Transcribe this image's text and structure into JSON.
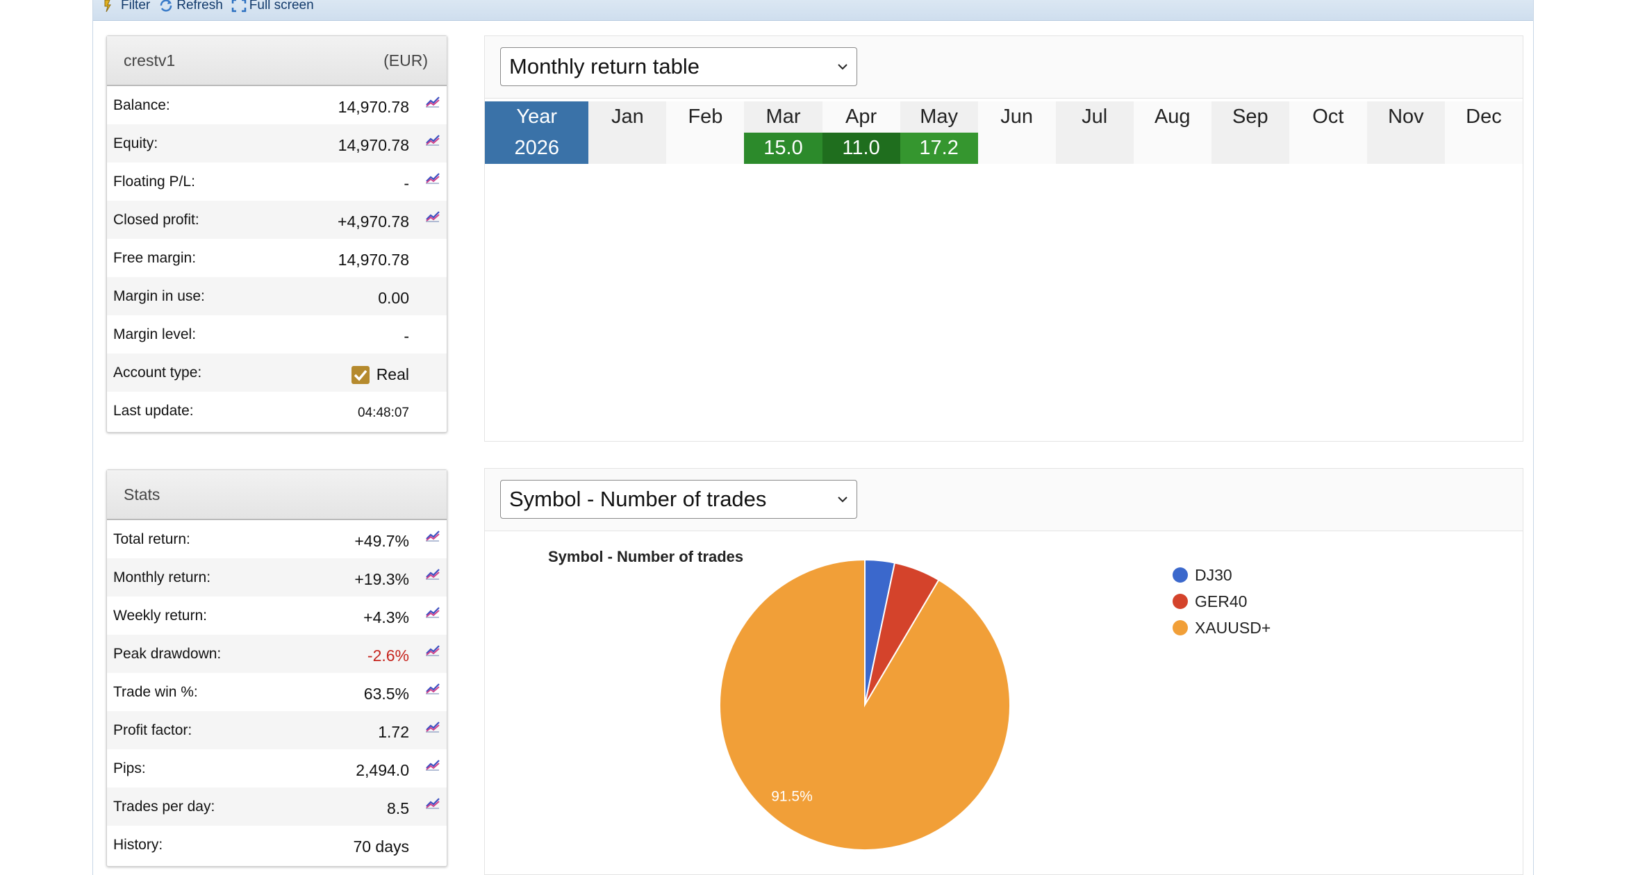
{
  "toolbar": {
    "filter_label": "Filter",
    "refresh_label": "Refresh",
    "fullscreen_label": "Full screen"
  },
  "account": {
    "name": "crestv1",
    "currency": "(EUR)",
    "rows": [
      {
        "label": "Balance:",
        "value": "14,970.78",
        "chart": true
      },
      {
        "label": "Equity:",
        "value": "14,970.78",
        "chart": true
      },
      {
        "label": "Floating P/L:",
        "value": "-",
        "chart": true
      },
      {
        "label": "Closed profit:",
        "value": "+4,970.78",
        "chart": true
      },
      {
        "label": "Free margin:",
        "value": "14,970.78",
        "chart": false
      },
      {
        "label": "Margin in use:",
        "value": "0.00",
        "chart": false
      },
      {
        "label": "Margin level:",
        "value": "-",
        "chart": false
      },
      {
        "label": "Account type:",
        "value": "Real",
        "chart": false
      },
      {
        "label": "Last update:",
        "value": "04:48:07",
        "chart": false
      }
    ]
  },
  "stats": {
    "title": "Stats",
    "rows": [
      {
        "label": "Total return:",
        "value": "+49.7%",
        "chart": true
      },
      {
        "label": "Monthly return:",
        "value": "+19.3%",
        "chart": true
      },
      {
        "label": "Weekly return:",
        "value": "+4.3%",
        "chart": true
      },
      {
        "label": "Peak drawdown:",
        "value": "-2.6%",
        "chart": true
      },
      {
        "label": "Trade win %:",
        "value": "63.5%",
        "chart": true
      },
      {
        "label": "Profit factor:",
        "value": "1.72",
        "chart": true
      },
      {
        "label": "Pips:",
        "value": "2,494.0",
        "chart": true
      },
      {
        "label": "Trades per day:",
        "value": "8.5",
        "chart": true
      },
      {
        "label": "History:",
        "value": "70 days",
        "chart": false
      }
    ]
  },
  "monthly": {
    "selected": "Monthly return table",
    "headers": [
      "Year",
      "Jan",
      "Feb",
      "Mar",
      "Apr",
      "May",
      "Jun",
      "Jul",
      "Aug",
      "Sep",
      "Oct",
      "Nov",
      "Dec"
    ],
    "rows": [
      {
        "year": "2026",
        "values": [
          "",
          "",
          "15.0",
          "11.0",
          "17.2",
          "",
          "",
          "",
          "",
          "",
          "",
          ""
        ]
      }
    ]
  },
  "symbol": {
    "selected": "Symbol - Number of trades"
  },
  "colors": {
    "dj30": "#3b68cc",
    "ger40": "#d4432b",
    "xauusd": "#f19f38",
    "accent": "#3a72a8",
    "positive": "#2c8a2b",
    "negative": "#c6241d"
  },
  "chart_data": {
    "type": "pie",
    "title": "Symbol - Number of trades",
    "categories": [
      "DJ30",
      "GER40",
      "XAUUSD+"
    ],
    "values": [
      3.3,
      5.2,
      91.5
    ],
    "slice_labels": [
      "",
      "",
      "91.5%"
    ],
    "legend": "right"
  }
}
